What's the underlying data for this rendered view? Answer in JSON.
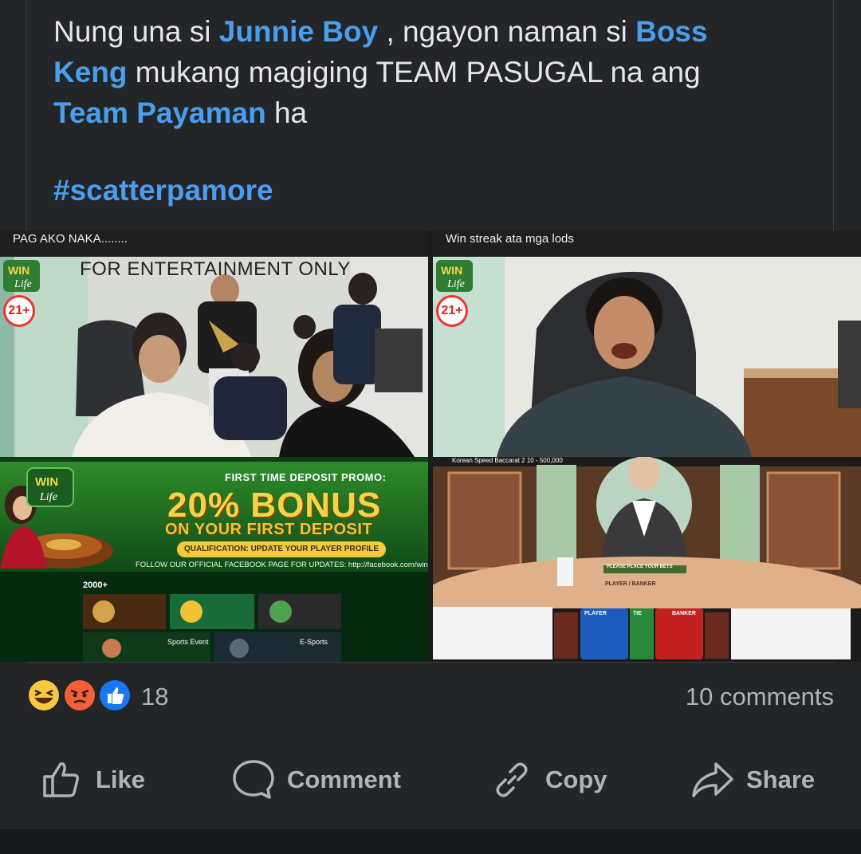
{
  "post": {
    "caption_part1": "Nung una si ",
    "mention1": "Junnie Boy",
    "caption_part2": " , ngayon naman si ",
    "mention2": "Boss Keng",
    "caption_part3": " mukang magiging TEAM PASUGAL na ang ",
    "mention3": "Team Payaman",
    "caption_part4": " ha",
    "hashtag": "#scatterpamore"
  },
  "media": {
    "left": {
      "caption": "PAG AKO NAKA........",
      "overlay": "FOR ENTERTAINMENT ONLY",
      "age_badge": "21+",
      "promo_title": "FIRST TIME DEPOSIT PROMO:",
      "promo_bonus": "20% BONUS",
      "promo_sub": "ON YOUR FIRST DEPOSIT",
      "promo_qual": "QUALIFICATION: UPDATE YOUR PLAYER PROFILE",
      "promo_follow": "FOLLOW OUR OFFICIAL FACEBOOK PAGE FOR UPDATES: http://facebook.com/winfor",
      "count_label": "2000+",
      "sports_event": "Sports Event",
      "esports": "E-Sports"
    },
    "right": {
      "caption": "Win streak ata mga lods",
      "age_badge": "21+",
      "table_title": "Korean Speed Baccarat 2 10 - 500,000",
      "place_bets": "PLEASE PLACE YOUR BETS",
      "player_banker": "PLAYER / BANKER",
      "player_label": "PLAYER",
      "tie_label": "TIE",
      "banker_label": "BANKER"
    }
  },
  "engagement": {
    "reaction_count": "18",
    "comments": "10 comments"
  },
  "actions": {
    "like": "Like",
    "comment": "Comment",
    "copy": "Copy",
    "share": "Share"
  },
  "colors": {
    "background": "#242526",
    "link": "#4a9ef0",
    "muted_text": "#b0b3b8",
    "like_blue": "#1877f2",
    "angry_orange": "#f2603a",
    "haha_yellow": "#f7c844"
  }
}
